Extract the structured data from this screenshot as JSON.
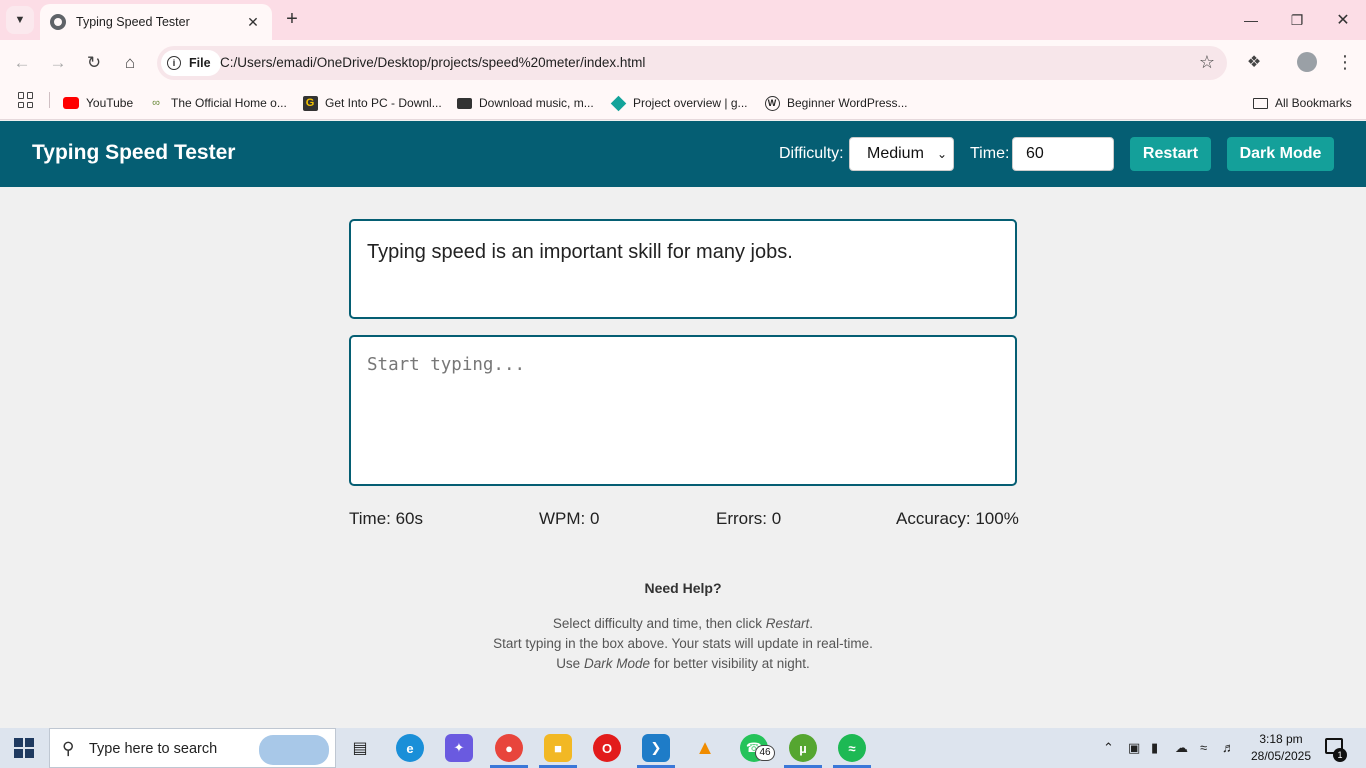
{
  "browser": {
    "tab_title": "Typing Speed Tester",
    "url_scheme_label": "File",
    "url": "C:/Users/emadi/OneDrive/Desktop/projects/speed%20meter/index.html",
    "bookmarks": [
      {
        "label": "YouTube",
        "icon": "youtube-icon"
      },
      {
        "label": "The Official Home o...",
        "icon": "site-icon"
      },
      {
        "label": "Get Into PC - Downl...",
        "icon": "getintopc-icon"
      },
      {
        "label": "Download music, m...",
        "icon": "music-icon"
      },
      {
        "label": "Project overview | g...",
        "icon": "diamond-icon"
      },
      {
        "label": "Beginner WordPress...",
        "icon": "wordpress-icon"
      }
    ],
    "all_bookmarks_label": "All Bookmarks"
  },
  "header": {
    "title": "Typing Speed Tester",
    "difficulty_label": "Difficulty:",
    "difficulty_value": "Medium",
    "time_label": "Time:",
    "time_value": "60",
    "restart_label": "Restart",
    "dark_mode_label": "Dark Mode"
  },
  "main": {
    "quote": "Typing speed is an important skill for many jobs.",
    "input_placeholder": "Start typing...",
    "stats": {
      "time": "Time: 60s",
      "wpm": "WPM: 0",
      "errors": "Errors: 0",
      "accuracy": "Accuracy: 100%"
    }
  },
  "help": {
    "title": "Need Help?",
    "line1_a": "Select difficulty and time, then click ",
    "line1_em": "Restart",
    "line1_b": ".",
    "line2": "Start typing in the box above. Your stats will update in real-time.",
    "line3_a": "Use ",
    "line3_em": "Dark Mode",
    "line3_b": " for better visibility at night."
  },
  "taskbar": {
    "search_placeholder": "Type here to search",
    "whatsapp_badge": "46",
    "time": "3:18 pm",
    "date": "28/05/2025",
    "notification_count": "1"
  },
  "colors": {
    "header_bg": "#055e73",
    "button_bg": "#14a09a",
    "tabstrip_bg": "#fcdde6"
  }
}
